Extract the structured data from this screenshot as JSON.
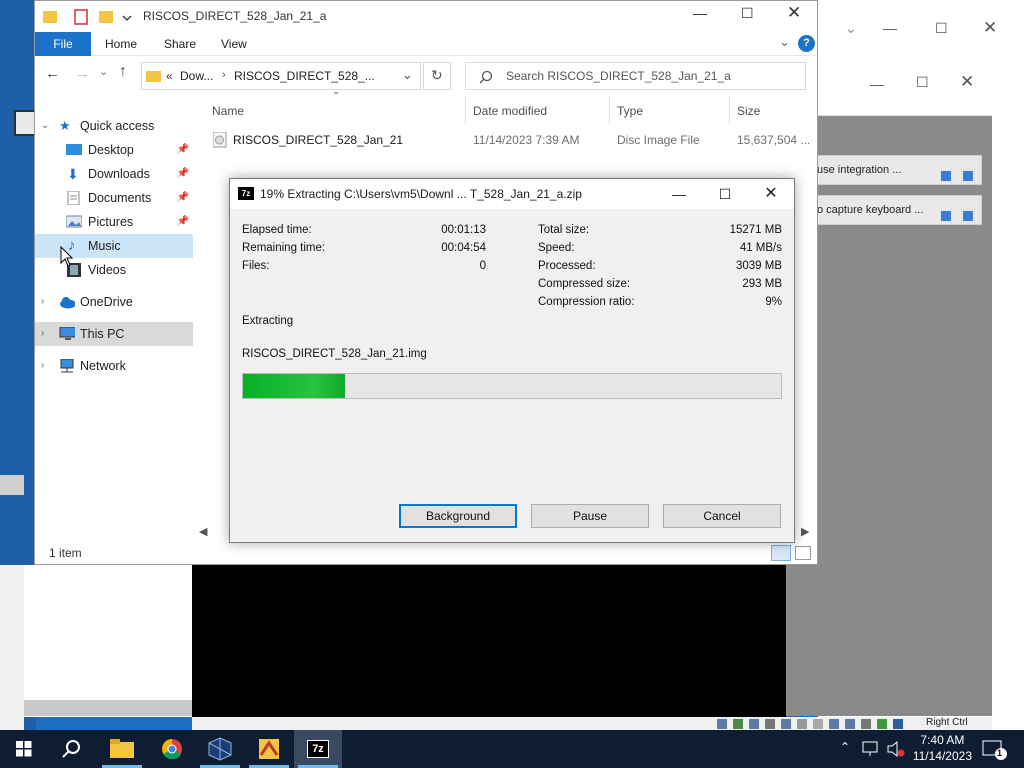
{
  "explorer": {
    "title": "RISCOS_DIRECT_528_Jan_21_a",
    "ribbon_tabs": [
      "File",
      "Home",
      "Share",
      "View"
    ],
    "address_prefix": "«",
    "address_part1": "Dow...",
    "address_part2": "RISCOS_DIRECT_528_...",
    "search_placeholder": "Search RISCOS_DIRECT_528_Jan_21_a",
    "nav": {
      "quick_access": "Quick access",
      "desktop": "Desktop",
      "downloads": "Downloads",
      "documents": "Documents",
      "pictures": "Pictures",
      "music": "Music",
      "videos": "Videos",
      "onedrive": "OneDrive",
      "this_pc": "This PC",
      "network": "Network"
    },
    "columns": {
      "name": "Name",
      "date": "Date modified",
      "type": "Type",
      "size": "Size"
    },
    "files": [
      {
        "name": "RISCOS_DIRECT_528_Jan_21",
        "date": "11/14/2023 7:39 AM",
        "type": "Disc Image File",
        "size": "15,637,504 ..."
      }
    ],
    "status": "1 item"
  },
  "vbox": {
    "notifications": [
      "use integration ...",
      "o capture keyboard ..."
    ],
    "host_key": "Right Ctrl"
  },
  "dialog": {
    "title": "19% Extracting C:\\Users\\vm5\\Downl ... T_528_Jan_21_a.zip",
    "icon_text": "7z",
    "left": {
      "elapsed_label": "Elapsed time:",
      "elapsed": "00:01:13",
      "remaining_label": "Remaining time:",
      "remaining": "00:04:54",
      "files_label": "Files:",
      "files": "0"
    },
    "right": {
      "total_label": "Total size:",
      "total": "15271 MB",
      "speed_label": "Speed:",
      "speed": "41 MB/s",
      "processed_label": "Processed:",
      "processed": "3039 MB",
      "compressed_label": "Compressed size:",
      "compressed": "293 MB",
      "ratio_label": "Compression ratio:",
      "ratio": "9%"
    },
    "status": "Extracting",
    "current_file": "RISCOS_DIRECT_528_Jan_21.img",
    "progress_percent": 19,
    "buttons": {
      "background": "Background",
      "pause": "Pause",
      "cancel": "Cancel"
    }
  },
  "taskbar": {
    "time": "7:40 AM",
    "date": "11/14/2023",
    "apps": [
      "windows-start",
      "search",
      "file-explorer",
      "chrome",
      "virtualbox",
      "unknown-app",
      "7zip"
    ],
    "notification_count": "1"
  }
}
